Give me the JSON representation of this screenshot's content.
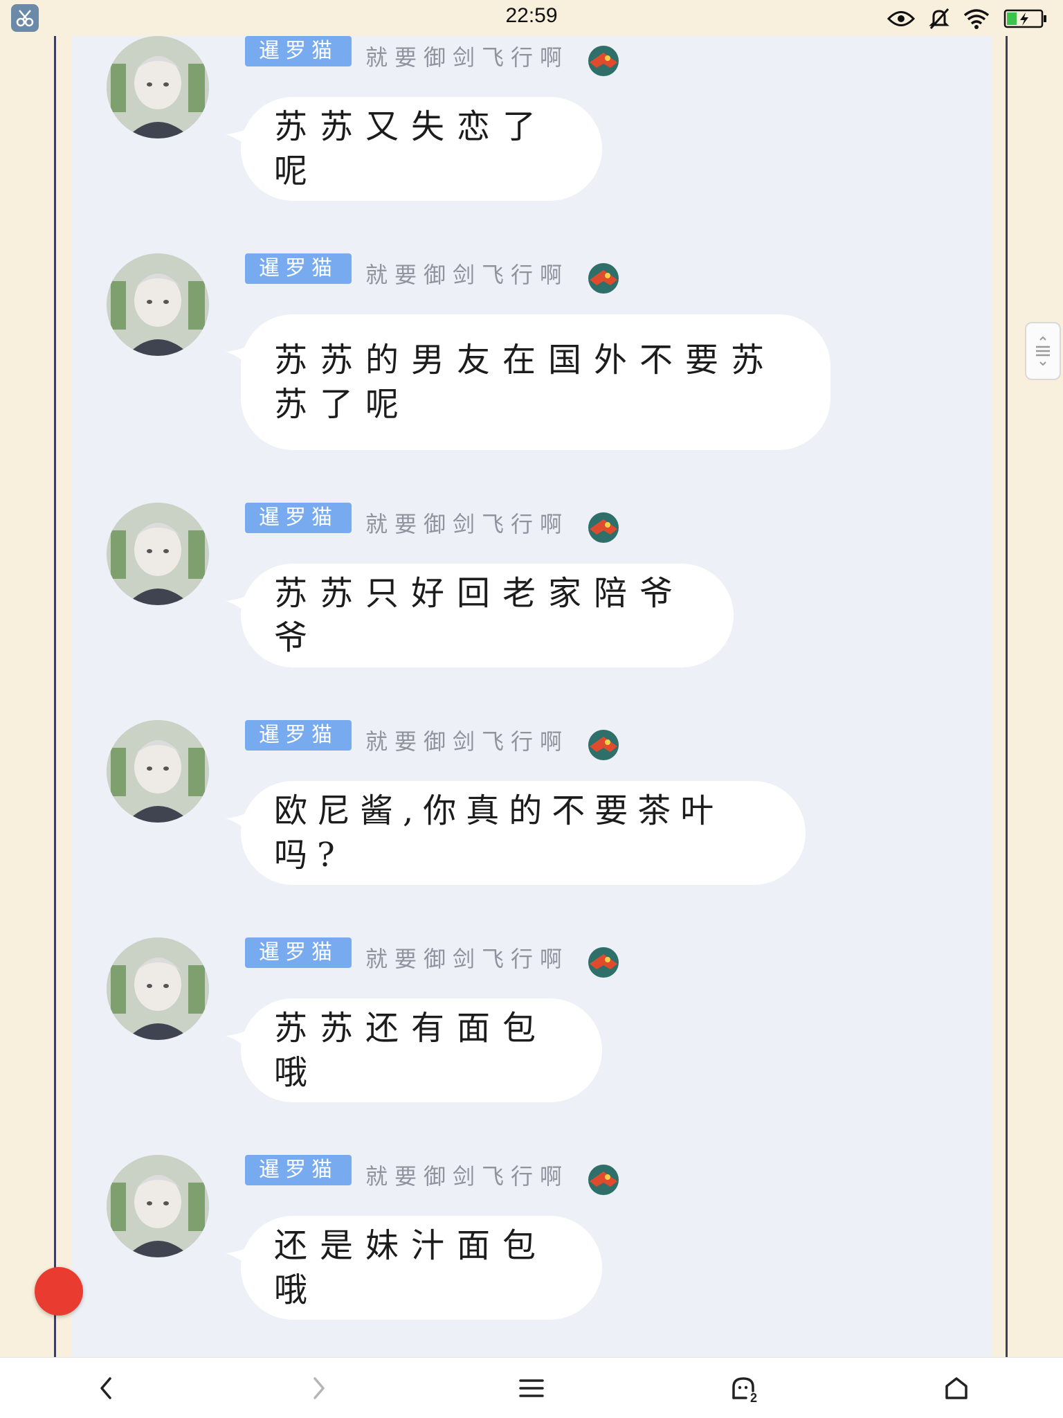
{
  "status_bar": {
    "time": "22:59",
    "icons": [
      "scissors-app-icon",
      "eye-icon",
      "mute-icon",
      "wifi-icon",
      "battery-charging-icon"
    ]
  },
  "messages": [
    {
      "badge": "暹罗猫",
      "nickname": "就要御剑飞行啊",
      "text": "苏苏又失恋了呢"
    },
    {
      "badge": "暹罗猫",
      "nickname": "就要御剑飞行啊",
      "text": "苏苏的男友在国外不要苏苏了呢"
    },
    {
      "badge": "暹罗猫",
      "nickname": "就要御剑飞行啊",
      "text": "苏苏只好回老家陪爷爷"
    },
    {
      "badge": "暹罗猫",
      "nickname": "就要御剑飞行啊",
      "text": "欧尼酱,你真的不要茶叶吗?"
    },
    {
      "badge": "暹罗猫",
      "nickname": "就要御剑飞行啊",
      "text": "苏苏还有面包哦"
    },
    {
      "badge": "暹罗猫",
      "nickname": "就要御剑飞行啊",
      "text": "还是妹汁面包哦"
    }
  ],
  "bottom_nav": {
    "tab_count": "2",
    "icons": [
      "back-icon",
      "forward-icon",
      "menu-icon",
      "tabs-icon",
      "home-icon"
    ]
  },
  "colors": {
    "background": "#f8efdc",
    "chat_panel": "#eef0f8",
    "badge": "#78aaf0",
    "bubble": "#ffffff",
    "frame_line": "#3e3d5f",
    "fab": "#ea3b30"
  }
}
